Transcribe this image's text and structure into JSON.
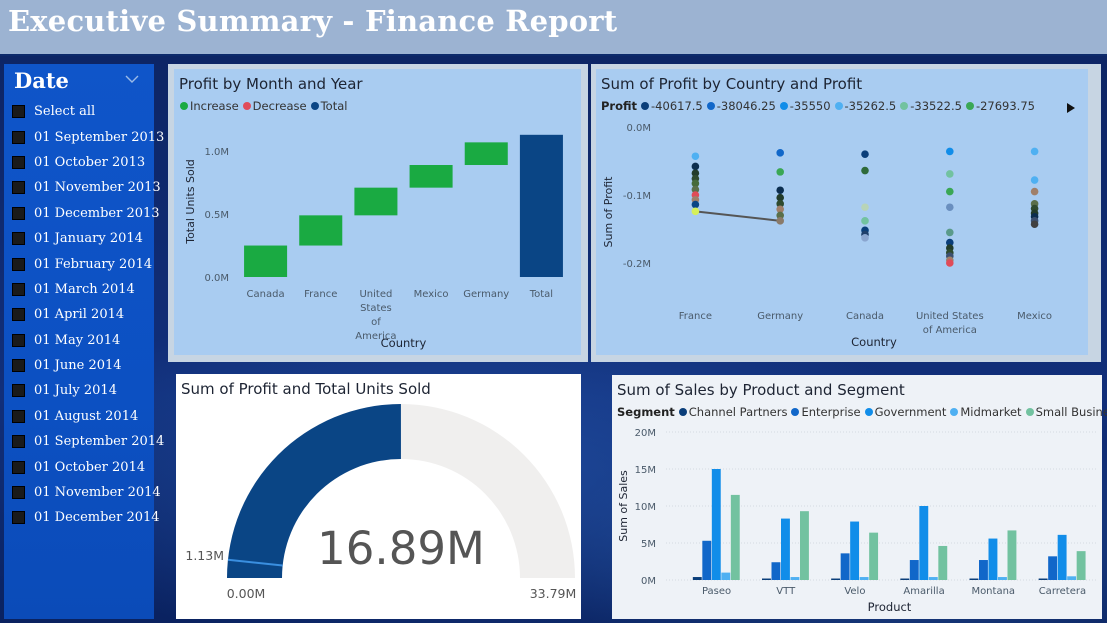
{
  "header": {
    "title": "Executive Summary - Finance Report"
  },
  "slicer": {
    "title": "Date",
    "items": [
      "Select all",
      "01 September 2013",
      "01 October 2013",
      "01 November 2013",
      "01 December 2013",
      "01 January 2014",
      "01 February 2014",
      "01 March 2014",
      "01 April 2014",
      "01 May 2014",
      "01 June 2014",
      "01 July 2014",
      "01 August 2014",
      "01 September 2014",
      "01 October 2014",
      "01 November 2014",
      "01 December 2014"
    ]
  },
  "colors": {
    "increase": "#1aaa42",
    "decrease": "#e04b59",
    "total": "#0a4585",
    "gauge_fill": "#0a4585",
    "gauge_track": "#f0efee",
    "channel_partners": "#0a3e7a",
    "enterprise": "#1167c9",
    "government": "#118de9",
    "midmarket": "#4fb0f2",
    "small_business": "#72c2a0"
  },
  "chart_data": [
    {
      "id": "waterfall",
      "type": "bar",
      "title": "Profit by Month and Year",
      "legend": [
        {
          "label": "Increase",
          "color": "#1aaa42"
        },
        {
          "label": "Decrease",
          "color": "#e04b59"
        },
        {
          "label": "Total",
          "color": "#0a4585"
        }
      ],
      "xlabel": "Country",
      "ylabel": "Total Units Sold",
      "categories": [
        "Canada",
        "France",
        "United States of America",
        "Mexico",
        "Germany",
        "Total"
      ],
      "category_lines": [
        [
          "Canada"
        ],
        [
          "France"
        ],
        [
          "United",
          "States",
          "of",
          "America"
        ],
        [
          "Mexico"
        ],
        [
          "Germany"
        ],
        [
          "Total"
        ]
      ],
      "increments": [
        0.25,
        0.24,
        0.22,
        0.18,
        0.18,
        null
      ],
      "total": 1.13,
      "ylim": [
        0,
        1.2
      ],
      "yticks": [
        0,
        0.5,
        1.0
      ],
      "ytick_labels": [
        "0.0M",
        "0.5M",
        "1.0M"
      ]
    },
    {
      "id": "country_profit",
      "type": "scatter",
      "title": "Sum of Profit by Country and Profit",
      "legend_title": "Profit",
      "legend": [
        {
          "label": "-40617.5",
          "color": "#0a3e7a"
        },
        {
          "label": "-38046.25",
          "color": "#1167c9"
        },
        {
          "label": "-35550",
          "color": "#118de9"
        },
        {
          "label": "-35262.5",
          "color": "#4fb0f2"
        },
        {
          "label": "-33522.5",
          "color": "#72c2a0"
        },
        {
          "label": "-27693.75",
          "color": "#3aa755"
        }
      ],
      "xlabel": "Country",
      "ylabel": "Sum of Profit",
      "categories": [
        "France",
        "Germany",
        "Canada",
        "United States of America",
        "Mexico"
      ],
      "category_lines": [
        [
          "France"
        ],
        [
          "Germany"
        ],
        [
          "Canada"
        ],
        [
          "United States",
          "of America"
        ],
        [
          "Mexico"
        ]
      ],
      "ylim": [
        -0.2,
        0
      ],
      "yticks": [
        0,
        -0.1,
        -0.2
      ],
      "ytick_labels": [
        "0.0M",
        "-0.1M",
        "-0.2M"
      ],
      "points": [
        [
          [
            -0.043,
            "#4fb0f2"
          ],
          [
            -0.058,
            "#0b2d4f"
          ],
          [
            -0.068,
            "#223b2a"
          ],
          [
            -0.076,
            "#2f4a2e"
          ],
          [
            -0.083,
            "#456a3a"
          ],
          [
            -0.092,
            "#5a6f4a"
          ],
          [
            -0.1,
            "#e04b59"
          ],
          [
            -0.107,
            "#a07f6a"
          ],
          [
            -0.114,
            "#0a4585"
          ],
          [
            -0.124,
            "#d6f05a"
          ]
        ],
        [
          [
            -0.038,
            "#1167c9"
          ],
          [
            -0.066,
            "#3aa755"
          ],
          [
            -0.093,
            "#0b2d4f"
          ],
          [
            -0.104,
            "#223b2a"
          ],
          [
            -0.113,
            "#2f4a2e"
          ],
          [
            -0.121,
            "#a07f6a"
          ],
          [
            -0.13,
            "#5a6f4a"
          ],
          [
            -0.138,
            "#8a7a6a"
          ]
        ],
        [
          [
            -0.04,
            "#0a3e7a"
          ],
          [
            -0.064,
            "#2f6a3a"
          ],
          [
            -0.082,
            "#a9ccf1"
          ],
          [
            -0.118,
            "#b8d4b8"
          ],
          [
            -0.138,
            "#72c2a0"
          ],
          [
            -0.152,
            "#0a3e7a"
          ],
          [
            -0.158,
            "#1f3f6a"
          ],
          [
            -0.163,
            "#8aa5cf"
          ]
        ],
        [
          [
            -0.036,
            "#118de9"
          ],
          [
            -0.069,
            "#72c2a0"
          ],
          [
            -0.095,
            "#3aa755"
          ],
          [
            -0.118,
            "#6a8fbf"
          ],
          [
            -0.155,
            "#5a9a8a"
          ],
          [
            -0.17,
            "#0a3e7a"
          ],
          [
            -0.178,
            "#223b2a"
          ],
          [
            -0.185,
            "#2f4a2e"
          ],
          [
            -0.19,
            "#3c5070"
          ],
          [
            -0.196,
            "#a07f6a"
          ],
          [
            -0.2,
            "#e04b59"
          ]
        ],
        [
          [
            -0.036,
            "#4fb0f2"
          ],
          [
            -0.078,
            "#4fb0f2"
          ],
          [
            -0.095,
            "#a07f6a"
          ],
          [
            -0.113,
            "#5a6f4a"
          ],
          [
            -0.12,
            "#2f4a2e"
          ],
          [
            -0.127,
            "#223b2a"
          ],
          [
            -0.132,
            "#0b2d4f"
          ],
          [
            -0.138,
            "#3c5070"
          ],
          [
            -0.143,
            "#404040"
          ]
        ]
      ],
      "line": {
        "from": [
          0,
          -0.124
        ],
        "to": [
          1,
          -0.138
        ],
        "color": "#555555"
      }
    },
    {
      "id": "gauge",
      "type": "gauge",
      "title": "Sum of Profit and Total Units Sold",
      "value_label": "16.89M",
      "value": 16.89,
      "min": 0,
      "max": 33.79,
      "target": 1.13,
      "min_label": "0.00M",
      "max_label": "33.79M",
      "target_label": "1.13M"
    },
    {
      "id": "product_segment",
      "type": "bar",
      "title": "Sum of Sales by Product and Segment",
      "legend_title": "Segment",
      "xlabel": "Product",
      "ylabel": "Sum of Sales",
      "categories": [
        "Paseo",
        "VTT",
        "Velo",
        "Amarilla",
        "Montana",
        "Carretera"
      ],
      "ylim": [
        0,
        20
      ],
      "yticks": [
        0,
        5,
        10,
        15,
        20
      ],
      "ytick_labels": [
        "0M",
        "5M",
        "10M",
        "15M",
        "20M"
      ],
      "series": [
        {
          "name": "Channel Partners",
          "color": "#0a3e7a",
          "values": [
            0.4,
            0.2,
            0.2,
            0.2,
            0.2,
            0.2
          ]
        },
        {
          "name": "Enterprise",
          "color": "#1167c9",
          "values": [
            5.3,
            2.4,
            3.6,
            2.7,
            2.7,
            3.2
          ]
        },
        {
          "name": "Government",
          "color": "#118de9",
          "values": [
            15.0,
            8.3,
            7.9,
            10.0,
            5.6,
            6.1
          ]
        },
        {
          "name": "Midmarket",
          "color": "#4fb0f2",
          "values": [
            1.0,
            0.4,
            0.4,
            0.4,
            0.4,
            0.5
          ]
        },
        {
          "name": "Small Business",
          "color": "#72c2a0",
          "values": [
            11.5,
            9.3,
            6.4,
            4.6,
            6.7,
            3.9
          ]
        }
      ]
    }
  ]
}
